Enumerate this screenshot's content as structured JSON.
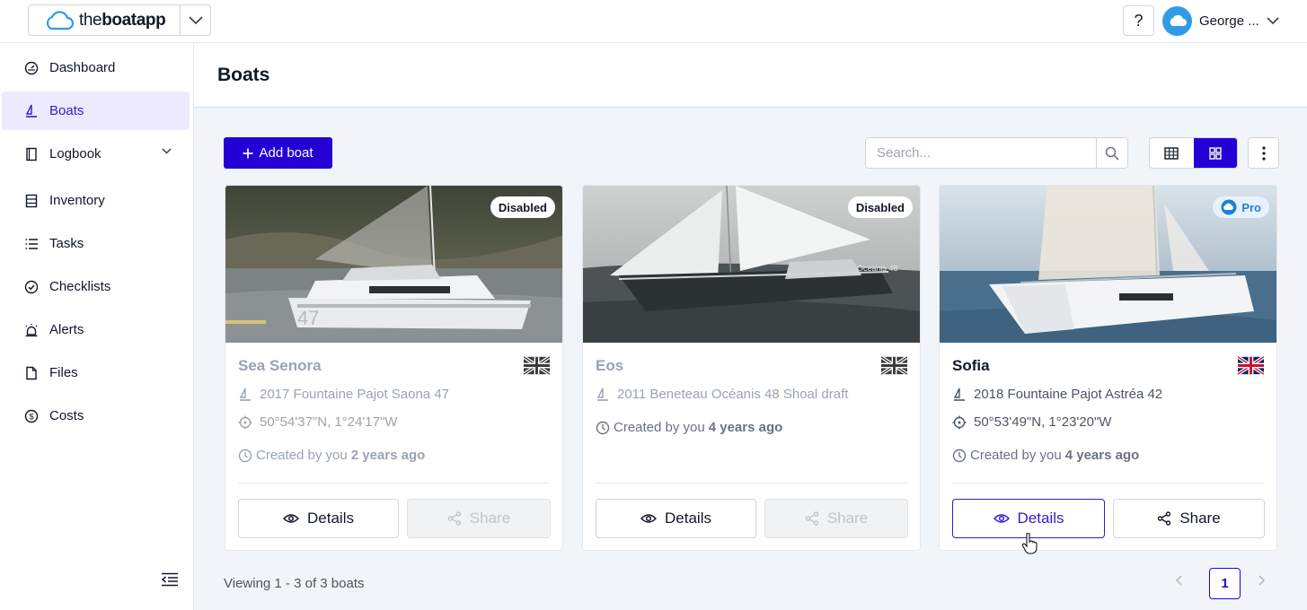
{
  "brand": {
    "prefix": "the",
    "name": "boatapp"
  },
  "header_user": {
    "help_label": "?",
    "name": "George ..."
  },
  "sidebar": {
    "items": [
      {
        "label": "Dashboard",
        "icon": "dashboard-icon"
      },
      {
        "label": "Boats",
        "icon": "sailboat-icon",
        "active": true
      },
      {
        "label": "Logbook",
        "icon": "book-icon",
        "expandable": true
      },
      {
        "label": "Inventory",
        "icon": "inventory-icon"
      },
      {
        "label": "Tasks",
        "icon": "list-icon"
      },
      {
        "label": "Checklists",
        "icon": "check-circle-icon"
      },
      {
        "label": "Alerts",
        "icon": "alarm-icon"
      },
      {
        "label": "Files",
        "icon": "file-icon"
      },
      {
        "label": "Costs",
        "icon": "dollar-circle-icon"
      }
    ]
  },
  "page": {
    "title": "Boats"
  },
  "toolbar": {
    "add_label": "Add boat",
    "search_placeholder": "Search...",
    "search_value": ""
  },
  "boats": [
    {
      "name": "Sea Senora",
      "badge": "Disabled",
      "model": "2017 Fountaine Pajot Saona 47",
      "location": "50°54'37\"N, 1°24'17\"W",
      "created_prefix": "Created by you",
      "created_ago": "2 years ago",
      "flag": "uk",
      "details_label": "Details",
      "share_label": "Share",
      "disabled": true
    },
    {
      "name": "Eos",
      "badge": "Disabled",
      "model": "2011 Beneteau Océanis 48 Shoal draft",
      "location": "",
      "created_prefix": "Created by you",
      "created_ago": "4 years ago",
      "flag": "uk",
      "details_label": "Details",
      "share_label": "Share",
      "disabled": true,
      "image_text": "Oceanis 48"
    },
    {
      "name": "Sofia",
      "badge": "Pro",
      "model": "2018 Fountaine Pajot Astréa 42",
      "location": "50°53'49\"N, 1°23'20\"W",
      "created_prefix": "Created by you",
      "created_ago": "4 years ago",
      "flag": "uk",
      "details_label": "Details",
      "share_label": "Share",
      "disabled": false
    }
  ],
  "footer": {
    "viewing": "Viewing 1 - 3 of 3 boats",
    "current_page": "1"
  },
  "colors": {
    "accent": "#2400d6",
    "active_bg": "#ede9fe",
    "pro_badge": "#1e7fd6"
  }
}
